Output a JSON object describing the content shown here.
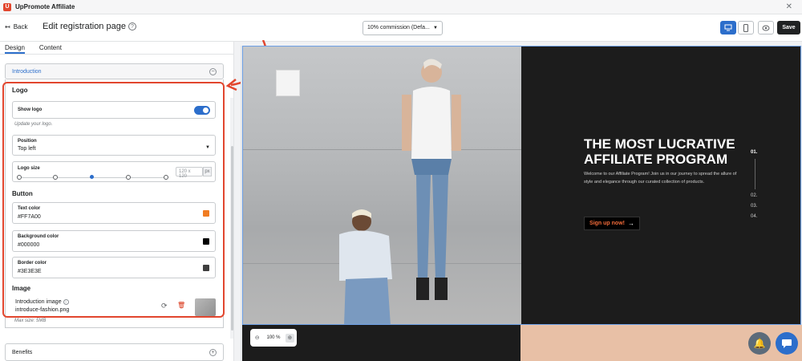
{
  "app": {
    "logo_text": "U",
    "title": "UpPromote Affiliate"
  },
  "toolbar": {
    "back": "Back",
    "page_title": "Edit registration page",
    "commission_select": "10% commission (Defa...",
    "save": "Save"
  },
  "tabs": [
    {
      "label": "Design"
    },
    {
      "label": "Content"
    }
  ],
  "sidebar": {
    "section_title": "Introduction",
    "logo": {
      "title": "Logo",
      "show_logo_label": "Show logo",
      "show_logo_enabled": true,
      "hint": "Update your logo.",
      "position_label": "Position",
      "position_value": "Top left",
      "size_label": "Logo size",
      "size_placeholder": "120 x 120",
      "size_unit": "px"
    },
    "button": {
      "title": "Button",
      "text_color_label": "Text color",
      "text_color_value": "#FF7A00",
      "bg_color_label": "Background color",
      "bg_color_value": "#000000",
      "border_color_label": "Border color",
      "border_color_value": "#3E3E3E"
    },
    "image": {
      "title": "Image",
      "intro_label": "Introduction image",
      "intro_file": "introduce-fashion.png",
      "max_size": "Max size: 5MB"
    },
    "benefits_title": "Benefits"
  },
  "preview": {
    "headline": "THE MOST LUCRATIVE AFFILIATE PROGRAM",
    "body": "Welcome to our Affiliate Program! Join us in our journey to spread the allure of style and elegance through our curated collection of products.",
    "cta": "Sign up now!",
    "nav": [
      "01.",
      "02.",
      "03.",
      "04."
    ]
  },
  "zoom": {
    "value": "100 %"
  },
  "colors": {
    "accent": "#2c6ecb",
    "highlight": "#e2462e",
    "orange": "#f26b3a"
  }
}
